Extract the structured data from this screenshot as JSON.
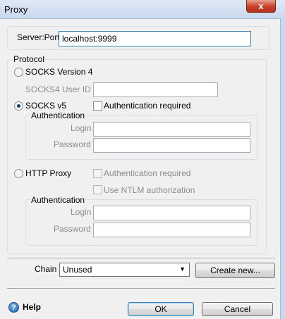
{
  "window": {
    "title": "Proxy",
    "close_glyph": "x"
  },
  "server": {
    "label": "Server:Port",
    "value": "localhost:9999"
  },
  "protocol": {
    "legend": "Protocol",
    "socks4": {
      "label": "SOCKS Version 4",
      "user_id_label": "SOCKS4 User ID",
      "user_id_value": "",
      "selected": false
    },
    "socks5": {
      "label": "SOCKS v5",
      "selected": true,
      "auth_required_label": "Authentication required",
      "auth_required": false,
      "auth_legend": "Authentication",
      "login_label": "Login",
      "login_value": "",
      "password_label": "Password",
      "password_value": ""
    },
    "http": {
      "label": "HTTP Proxy",
      "selected": false,
      "auth_required_label": "Authentication required",
      "auth_required": false,
      "ntlm_label": "Use NTLM authorization",
      "ntlm": false,
      "auth_legend": "Authentication",
      "login_label": "Login",
      "login_value": "",
      "password_label": "Password",
      "password_value": ""
    }
  },
  "chain": {
    "label": "Chain",
    "selected": "Unused",
    "create_new_label": "Create new..."
  },
  "footer": {
    "help_label": "Help",
    "help_icon": "question-circle-icon",
    "ok_label": "OK",
    "cancel_label": "Cancel"
  },
  "colors": {
    "accent": "#3c7fb1",
    "close_red": "#c9402a",
    "disabled_text": "#8c8c8c"
  }
}
